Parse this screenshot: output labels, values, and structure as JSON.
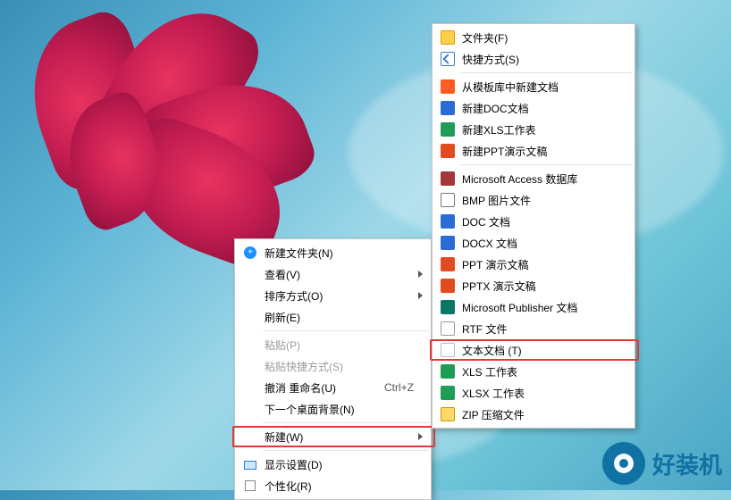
{
  "main_menu": {
    "new_folder": "新建文件夹(N)",
    "view": "查看(V)",
    "sort_by": "排序方式(O)",
    "refresh": "刷新(E)",
    "paste": "粘贴(P)",
    "paste_shortcut": "粘贴快捷方式(S)",
    "undo_rename": "撤消 重命名(U)",
    "undo_shortcut": "Ctrl+Z",
    "next_bg": "下一个桌面背景(N)",
    "new": "新建(W)",
    "display": "显示设置(D)",
    "personalize": "个性化(R)"
  },
  "sub_menu": {
    "folder": "文件夹(F)",
    "shortcut": "快捷方式(S)",
    "wps_template": "从模板库中新建文档",
    "doc": "新建DOC文档",
    "xls": "新建XLS工作表",
    "ppt": "新建PPT演示文稿",
    "access": "Microsoft Access 数据库",
    "bmp": "BMP 图片文件",
    "doc2": "DOC 文档",
    "docx": "DOCX 文档",
    "ppt2": "PPT 演示文稿",
    "pptx": "PPTX 演示文稿",
    "publisher": "Microsoft Publisher 文档",
    "rtf": "RTF 文件",
    "txt": "文本文档 (T)",
    "xls2": "XLS 工作表",
    "xlsx": "XLSX 工作表",
    "zip": "ZIP 压缩文件"
  },
  "brand": "好装机"
}
